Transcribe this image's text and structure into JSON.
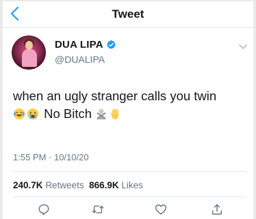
{
  "header": {
    "title": "Tweet",
    "back_icon": "chevron-left-icon"
  },
  "author": {
    "display_name": "DUA LIPA",
    "handle": "@DUALIPA",
    "verified": true,
    "avatar": "avatar-photo"
  },
  "tweet": {
    "text_line1": "when an ugly stranger calls you twin",
    "text_line2": "No Bitch",
    "emojis_before": [
      "laughing-tears-emoji",
      "crying-face-emoji"
    ],
    "emojis_after": [
      "person-gesturing-no-emoji",
      "raised-hand-emoji"
    ]
  },
  "meta": {
    "timestamp": "1:55 PM · 10/10/20"
  },
  "stats": {
    "retweets_count": "240.7K",
    "retweets_label": "Retweets",
    "likes_count": "866.9K",
    "likes_label": "Likes"
  },
  "actions": [
    "reply-icon",
    "retweet-icon",
    "like-icon",
    "share-icon"
  ],
  "colors": {
    "accent": "#1da1f2",
    "text": "#14171a",
    "secondary_text": "#657786",
    "divider": "#e1e8ed"
  }
}
